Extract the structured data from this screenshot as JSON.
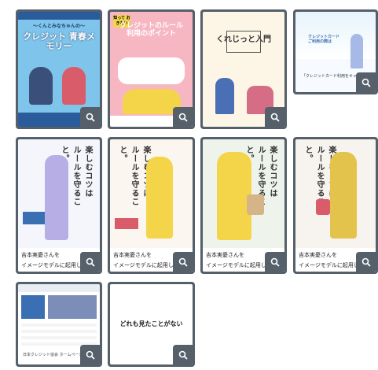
{
  "posters": [
    {
      "id": "p1",
      "title": "クレジット 青春メモリー",
      "subtitle": "〜くんとみなちゃんの〜"
    },
    {
      "id": "p2",
      "title": "クレジットのルール 利用のポイント",
      "badge": "知って おきたい"
    },
    {
      "id": "p3",
      "title": "くれじっと入門"
    },
    {
      "id": "p4",
      "title": "クレジットカード ご利用の際は",
      "caption": "「クレジットカード利用をキャンペーン」"
    }
  ],
  "ads": [
    {
      "headline": "楽しむコツは ルールを守ること。",
      "caption_name": "吉本実憂さんを",
      "caption_desc": "イメージモデルに起用した"
    },
    {
      "headline": "楽しむコツは ルールを守ること。",
      "caption_name": "吉本実憂さんを",
      "caption_desc": "イメージモデルに起用したポ"
    },
    {
      "headline": "楽しむコツは ルールを守ること。",
      "caption_name": "吉本実憂さんを",
      "caption_desc": "イメージモデルに起用したポス"
    },
    {
      "headline": "楽しむコツは ルールを守ること。",
      "caption_name": "吉本実憂さんを",
      "caption_desc": "イメージモデルに起用したポス"
    }
  ],
  "row3": {
    "website_caption": "日本クレジット協会 ホームページ",
    "text_card": "どれも見たことがない"
  },
  "colors": {
    "frame": "#55606a",
    "pink": "#f6b7c3",
    "blue": "#3b6fb3",
    "yellow": "#f4d54a"
  },
  "icons": {
    "zoom": "magnifier-icon"
  }
}
